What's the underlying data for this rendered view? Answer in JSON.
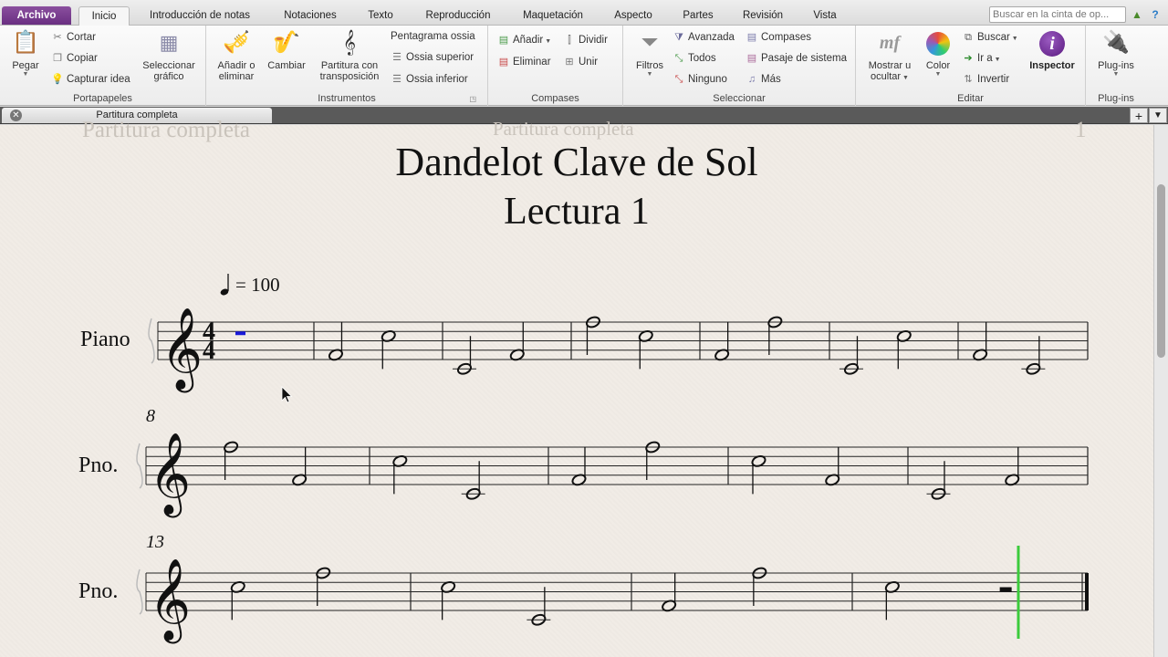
{
  "tabs": {
    "file": "Archivo",
    "items": [
      "Inicio",
      "Introducción de notas",
      "Notaciones",
      "Texto",
      "Reproducción",
      "Maquetación",
      "Aspecto",
      "Partes",
      "Revisión",
      "Vista"
    ]
  },
  "search": {
    "placeholder": "Buscar en la cinta de op..."
  },
  "ribbon": {
    "clipboard": {
      "label": "Portapapeles",
      "paste": "Pegar",
      "cut": "Cortar",
      "copy": "Copiar",
      "capture": "Capturar idea",
      "select_graphic_1": "Seleccionar",
      "select_graphic_2": "gráfico"
    },
    "instruments": {
      "label": "Instrumentos",
      "add_1": "Añadir o",
      "add_2": "eliminar",
      "change": "Cambiar",
      "transposing_1": "Partitura con",
      "transposing_2": "transposición",
      "ossia_staff": "Pentagrama ossia",
      "ossia_above": "Ossia superior",
      "ossia_below": "Ossia inferior"
    },
    "bars": {
      "label": "Compases",
      "add": "Añadir",
      "delete": "Eliminar",
      "split": "Dividir",
      "join": "Unir"
    },
    "select": {
      "label": "Seleccionar",
      "filters": "Filtros",
      "advanced": "Avanzada",
      "all": "Todos",
      "none": "Ninguno",
      "bars": "Compases",
      "system_passage": "Pasaje de sistema",
      "more": "Más"
    },
    "edit": {
      "label": "Editar",
      "show_hide_1": "Mostrar u",
      "show_hide_2": "ocultar",
      "color": "Color",
      "find": "Buscar",
      "goto": "Ir a",
      "invert": "Invertir",
      "inspector": "Inspector"
    },
    "plugins": {
      "label": "Plug-ins",
      "button": "Plug-ins"
    }
  },
  "document": {
    "tab_title": "Partitura completa"
  },
  "score": {
    "header_ghost_left": "Partitura completa",
    "header_ghost_center": "Partitura completa",
    "page_number": "1",
    "title": "Dandelot Clave de Sol",
    "subtitle": "Lectura 1",
    "tempo_text": "= 100",
    "instrument_full": "Piano",
    "instrument_short": "Pno.",
    "time_signature": [
      "4",
      "4"
    ],
    "systems": [
      {
        "start_measure": "",
        "measures": [
          [
            "rest"
          ],
          [
            "G4",
            "C5"
          ],
          [
            "C4",
            "G4"
          ],
          [
            "G5",
            "C5"
          ],
          [
            "G4",
            "G5"
          ],
          [
            "C4",
            "C5"
          ],
          [
            "G4",
            "C4"
          ]
        ]
      },
      {
        "start_measure": "8",
        "measures": [
          [
            "G5",
            "G4"
          ],
          [
            "C5",
            "C4"
          ],
          [
            "G4",
            "G5"
          ],
          [
            "C5",
            "G4"
          ],
          [
            "C4",
            "G4"
          ]
        ]
      },
      {
        "start_measure": "13",
        "measures": [
          [
            "C5",
            "G5"
          ],
          [
            "C5",
            "C4"
          ],
          [
            "G4",
            "G5"
          ],
          [
            "C5",
            "rest"
          ]
        ]
      }
    ]
  },
  "colors": {
    "accent_file": "#6a2f82",
    "playback_line": "#3ccb3c",
    "selection": "#1a1ad8"
  }
}
